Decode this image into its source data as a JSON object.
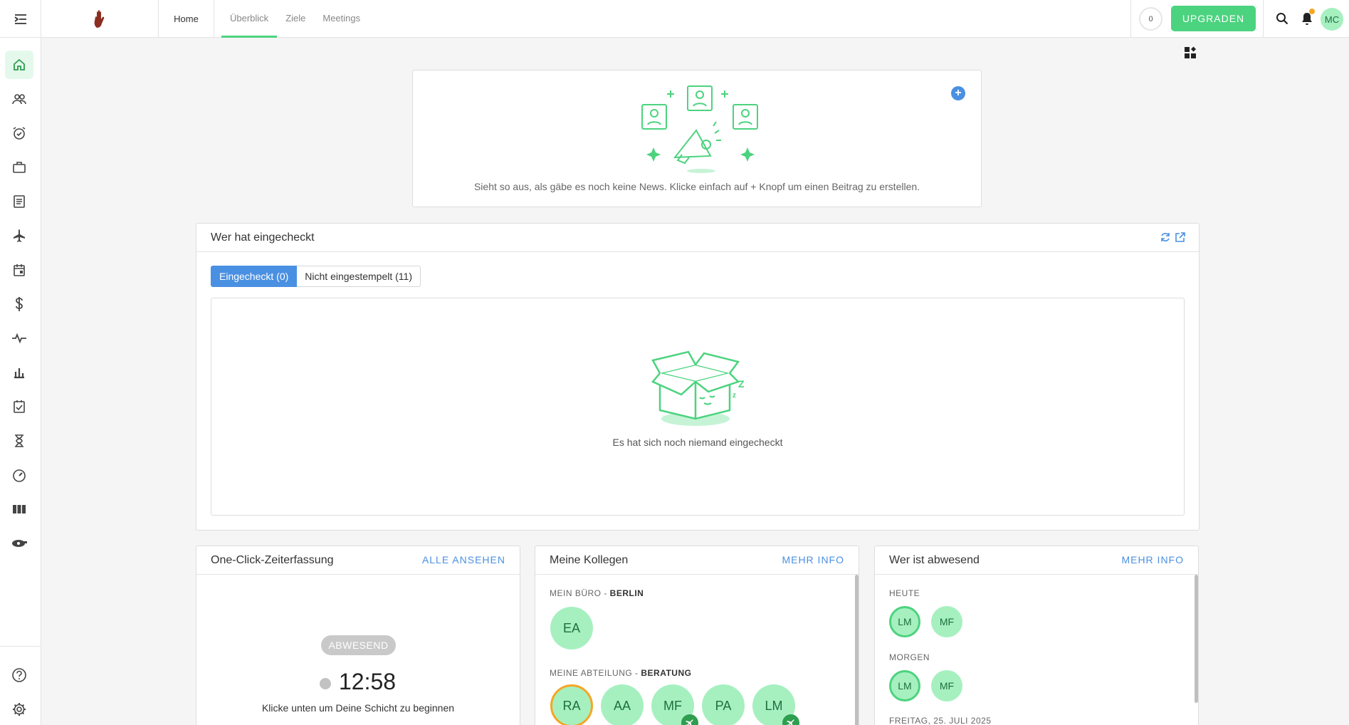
{
  "topbar": {
    "home_label": "Home",
    "tabs": [
      {
        "label": "Überblick",
        "active": true
      },
      {
        "label": "Ziele",
        "active": false
      },
      {
        "label": "Meetings",
        "active": false
      }
    ],
    "counter": "0",
    "upgrade_label": "UPGRADEN",
    "user_initials": "MC"
  },
  "sidebar": {
    "items": [
      {
        "icon": "home-icon",
        "active": true
      },
      {
        "icon": "people-icon"
      },
      {
        "icon": "alarm-clock-icon"
      },
      {
        "icon": "briefcase-icon"
      },
      {
        "icon": "document-icon"
      },
      {
        "icon": "airplane-icon"
      },
      {
        "icon": "calendar-icon"
      },
      {
        "icon": "dollar-icon"
      },
      {
        "icon": "pulse-icon"
      },
      {
        "icon": "bar-chart-icon"
      },
      {
        "icon": "checkbox-icon"
      },
      {
        "icon": "hourglass-icon"
      },
      {
        "icon": "gauge-icon"
      },
      {
        "icon": "columns-icon"
      },
      {
        "icon": "whistle-icon"
      }
    ],
    "bottom_items": [
      {
        "icon": "help-icon"
      },
      {
        "icon": "settings-icon"
      }
    ]
  },
  "news": {
    "empty_message": "Sieht so aus, als gäbe es noch keine News. Klicke einfach auf + Knopf um einen Beitrag zu erstellen.",
    "add_symbol": "+"
  },
  "checkin": {
    "title": "Wer hat eingecheckt",
    "tab_checked_in": "Eingecheckt (0)",
    "tab_not_clocked": "Nicht eingestempelt (11)",
    "empty_message": "Es hat sich noch niemand eingecheckt"
  },
  "oneclick": {
    "title": "One-Click-Zeiterfassung",
    "action": "ALLE ANSEHEN",
    "status": "ABWESEND",
    "time": "12:58",
    "hint": "Klicke unten um Deine Schicht zu beginnen"
  },
  "colleagues": {
    "title": "Meine Kollegen",
    "action": "MEHR INFO",
    "office_label": "MEIN BÜRO - ",
    "office_name": "BERLIN",
    "office_members": [
      "EA"
    ],
    "dept_label": "MEINE ABTEILUNG - ",
    "dept_name": "BERATUNG",
    "dept_members": [
      "RA",
      "AA",
      "MF",
      "PA",
      "LM"
    ]
  },
  "absent": {
    "title": "Wer ist abwesend",
    "action": "MEHR INFO",
    "today_label": "HEUTE",
    "today": [
      "LM",
      "MF"
    ],
    "tomorrow_label": "MORGEN",
    "tomorrow": [
      "LM",
      "MF"
    ],
    "next_label": "FREITAG, 25. JULI 2025"
  },
  "colors": {
    "accent_green": "#4cd37f",
    "accent_blue": "#4a90e2",
    "avatar_green": "#a6f0c0",
    "warning_orange": "#f5a623"
  }
}
